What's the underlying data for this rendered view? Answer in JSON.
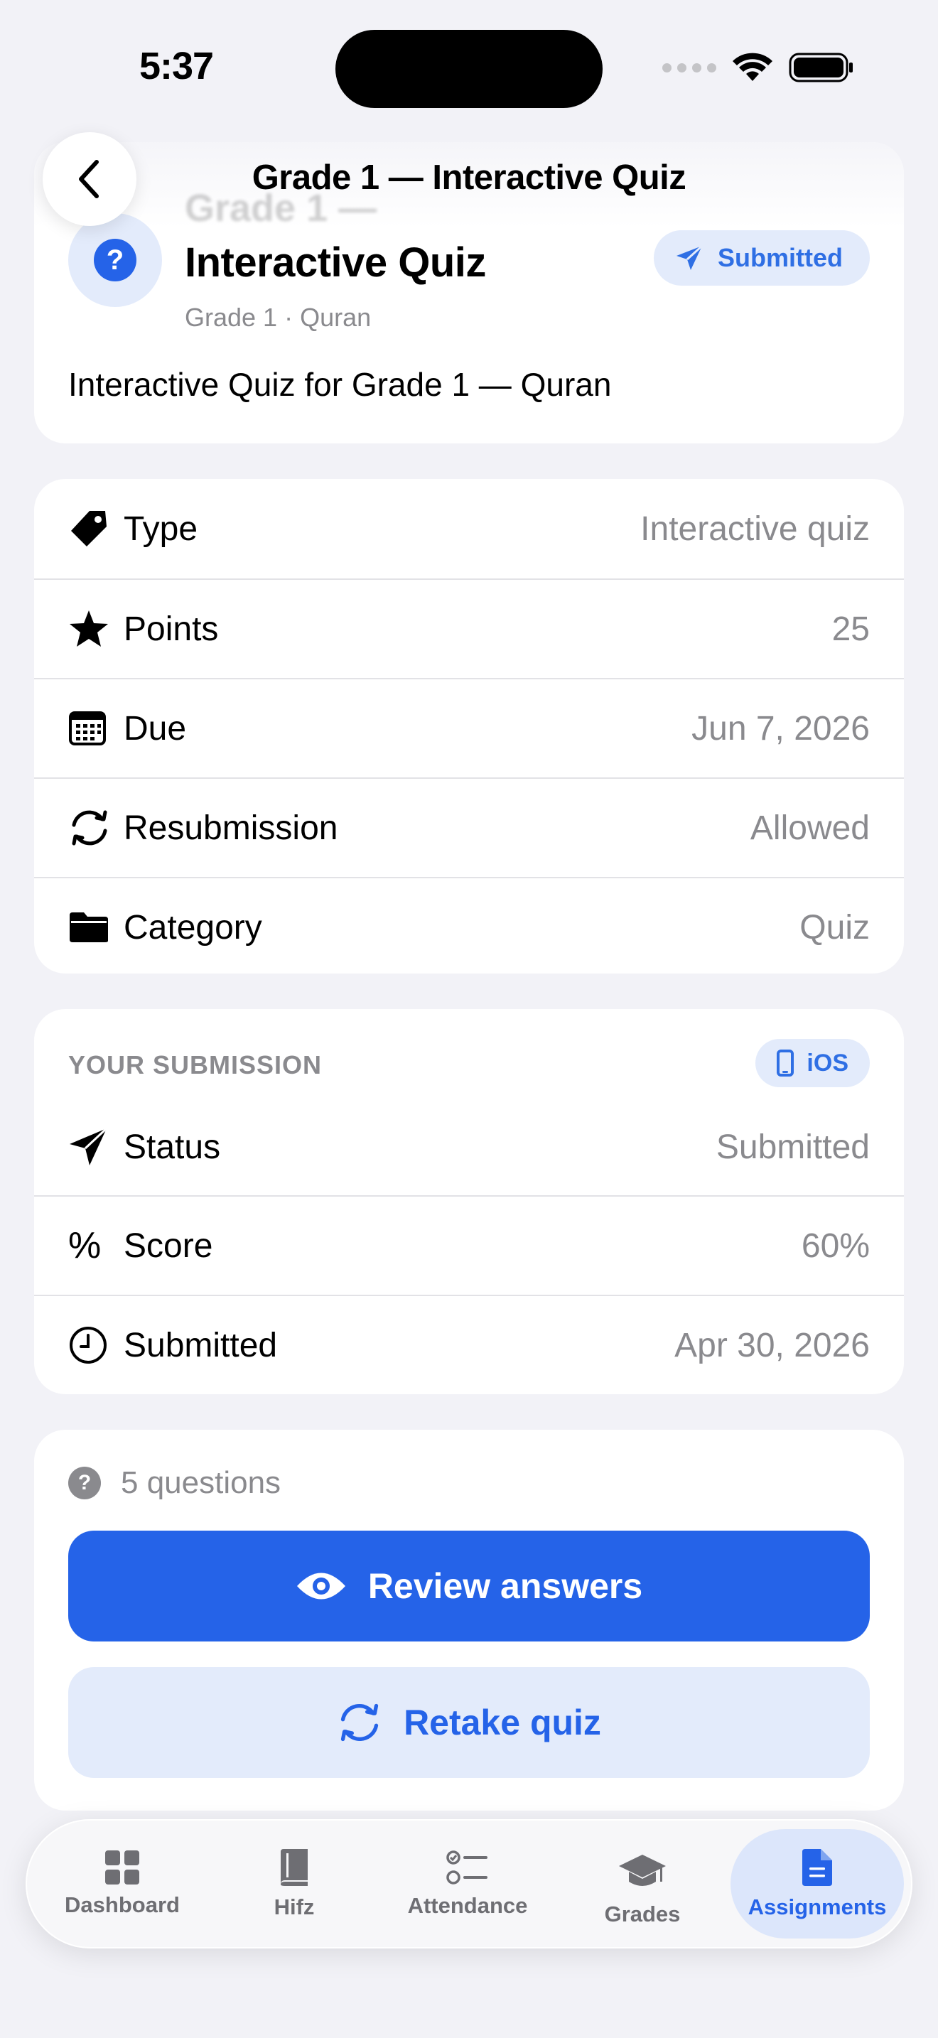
{
  "status_bar": {
    "time": "5:37"
  },
  "header": {
    "title": "Grade 1 — Interactive Quiz"
  },
  "summary": {
    "ghost_title": "Grade 1 —",
    "title": "Interactive Quiz",
    "subtitle": "Grade 1 · Quran",
    "badge": "Submitted",
    "description": "Interactive Quiz for Grade 1 — Quran"
  },
  "details": [
    {
      "label": "Type",
      "value": "Interactive quiz",
      "icon": "tag-icon"
    },
    {
      "label": "Points",
      "value": "25",
      "icon": "star-icon"
    },
    {
      "label": "Due",
      "value": "Jun 7, 2026",
      "icon": "calendar-icon"
    },
    {
      "label": "Resubmission",
      "value": "Allowed",
      "icon": "refresh-icon"
    },
    {
      "label": "Category",
      "value": "Quiz",
      "icon": "folder-icon"
    }
  ],
  "submission": {
    "heading": "YOUR SUBMISSION",
    "platform": "iOS",
    "rows": [
      {
        "label": "Status",
        "value": "Submitted",
        "icon": "paperplane-icon"
      },
      {
        "label": "Score",
        "value": "60%",
        "icon": "percent-icon"
      },
      {
        "label": "Submitted",
        "value": "Apr 30, 2026",
        "icon": "clock-icon"
      }
    ]
  },
  "quiz": {
    "question_count": "5 questions",
    "review_label": "Review answers",
    "retake_label": "Retake quiz"
  },
  "tabs": [
    {
      "label": "Dashboard",
      "icon": "grid-icon",
      "active": false
    },
    {
      "label": "Hifz",
      "icon": "book-icon",
      "active": false
    },
    {
      "label": "Attendance",
      "icon": "checklist-icon",
      "active": false
    },
    {
      "label": "Grades",
      "icon": "graduation-cap-icon",
      "active": false
    },
    {
      "label": "Assignments",
      "icon": "document-icon",
      "active": true
    }
  ],
  "colors": {
    "accent": "#2563e8",
    "accent_light": "#e3ebfb",
    "background": "#f2f2f7",
    "secondary_text": "#8a8a8e"
  }
}
